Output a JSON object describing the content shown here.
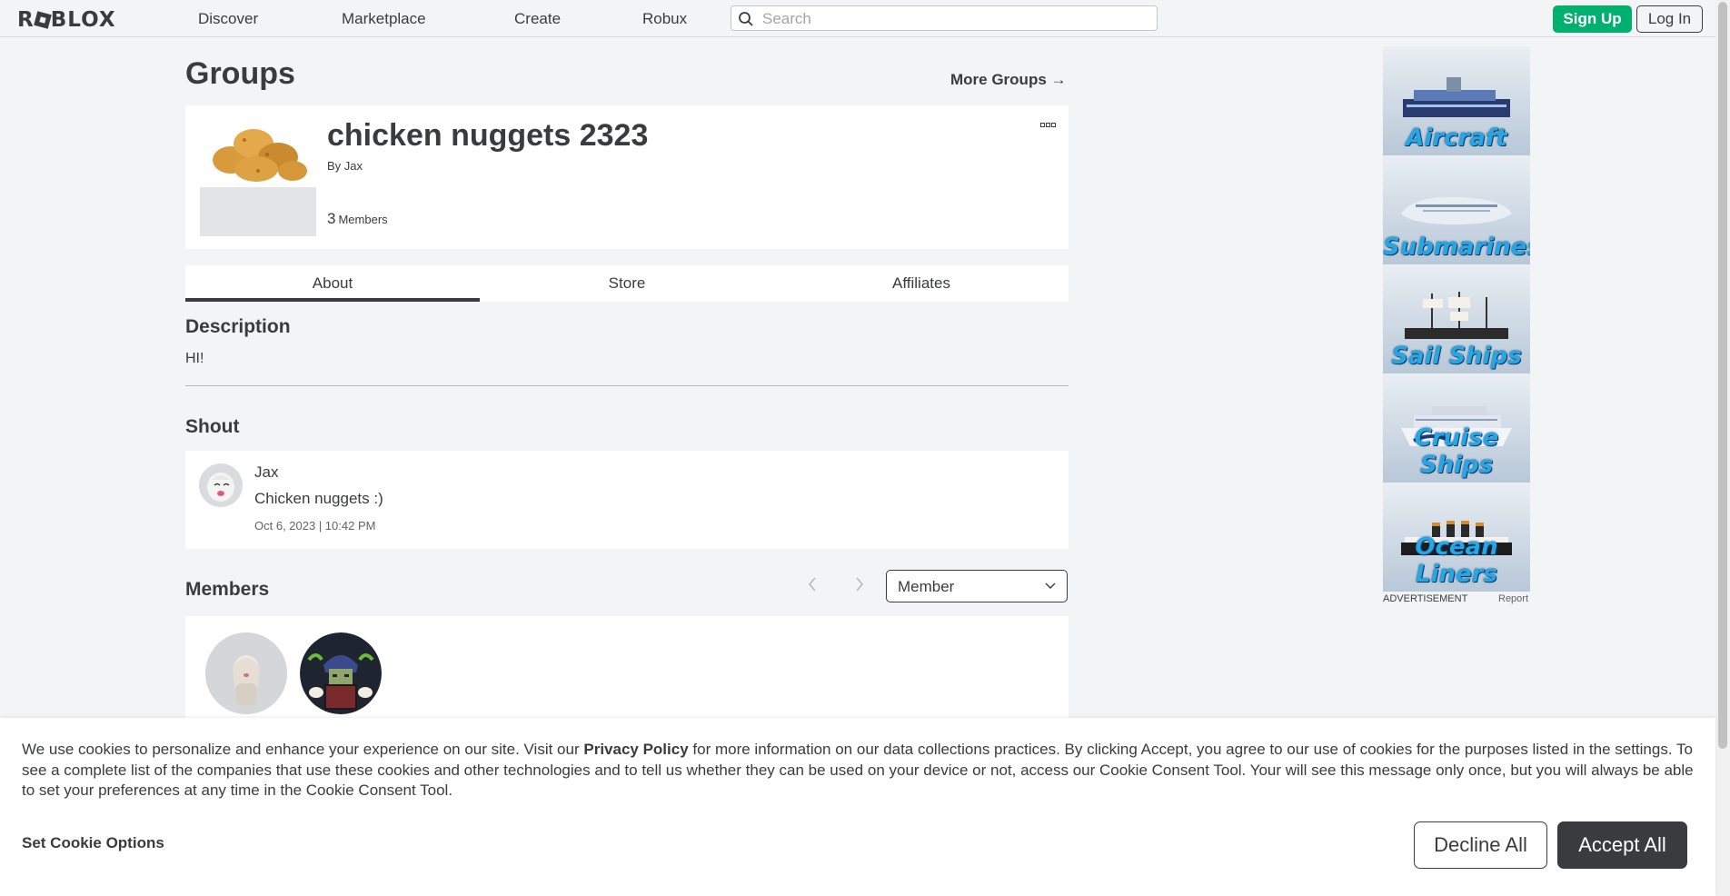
{
  "header": {
    "logo": "ROBLOX",
    "nav": [
      "Discover",
      "Marketplace",
      "Create",
      "Robux"
    ],
    "search_placeholder": "Search",
    "signup_label": "Sign Up",
    "login_label": "Log In"
  },
  "page": {
    "title": "Groups",
    "more_groups": "More Groups →"
  },
  "group": {
    "name": "chicken nuggets 2323",
    "by_prefix": "By",
    "owner": "Jax",
    "member_count": "3",
    "member_label": "Members"
  },
  "tabs": [
    {
      "label": "About",
      "active": true
    },
    {
      "label": "Store",
      "active": false
    },
    {
      "label": "Affiliates",
      "active": false
    }
  ],
  "about": {
    "description_heading": "Description",
    "description_text": "HI!",
    "shout_heading": "Shout",
    "shout": {
      "user": "Jax",
      "body": "Chicken nuggets :)",
      "date": "Oct 6, 2023 | 10:42 PM"
    },
    "members_heading": "Members",
    "role_selected": "Member"
  },
  "ad": {
    "panels": [
      "Aircraft",
      "Submarines",
      "Sail Ships",
      "Cruise Ships",
      "Ocean Liners"
    ],
    "label": "ADVERTISEMENT",
    "report": "Report"
  },
  "cookie": {
    "text_before": "We use cookies to personalize and enhance your experience on our site. Visit our ",
    "policy_link": "Privacy Policy",
    "text_after": " for more information on our data collections practices. By clicking Accept, you agree to our use of cookies for the purposes listed in the settings. To see a complete list of the companies that use these cookies and other technologies and to tell us whether they can be used on your device or not, access our Cookie Consent Tool. Your will see this message only once, but you will always be able to set your preferences at any time in the Cookie Consent Tool.",
    "options_label": "Set Cookie Options",
    "decline_label": "Decline All",
    "accept_label": "Accept All"
  },
  "colors": {
    "accent_green": "#00b06f",
    "text_dark": "#393b3d",
    "background": "#f2f4f5"
  }
}
